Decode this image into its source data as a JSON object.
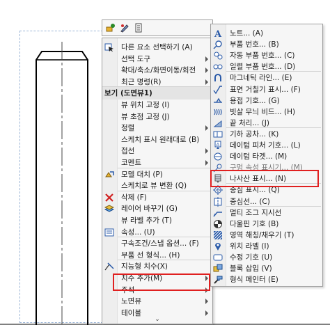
{
  "toolbar": {
    "icons": [
      "smart-dimension-icon",
      "annotation-pen-icon",
      "document-properties-icon"
    ]
  },
  "context_menu": {
    "items": [
      {
        "label": "다른 요소 선택하기 (A)",
        "icon": "select-other-icon"
      },
      {
        "label": "선택 도구",
        "submenu": true
      },
      {
        "label": "확대/축소/화면이동/회전",
        "submenu": true
      },
      {
        "label": "최근 명령(R)",
        "submenu": true
      },
      {
        "label": "보기 (도면뷰1)",
        "section": true
      },
      {
        "label": "뷰 위치 고정 (I)"
      },
      {
        "label": "뷰 초점 고정 (J)"
      },
      {
        "label": "정렬",
        "submenu": true
      },
      {
        "label": "스케치 표시 원래대로 (B)"
      },
      {
        "label": "접선",
        "submenu": true
      },
      {
        "label": "코멘트",
        "submenu": true
      },
      {
        "label": "모델 대치 (P)",
        "icon": "replace-model-icon"
      },
      {
        "label": "스케치로 뷰 변환 (Q)"
      },
      {
        "label": "삭제 (F)",
        "icon": "delete-icon"
      },
      {
        "label": "레이어 바꾸기 (G)",
        "icon": "change-layer-icon"
      },
      {
        "label": "뷰 라벨 추가 (T)"
      },
      {
        "label": "속성... (U)",
        "icon": "properties-icon"
      },
      {
        "label": "구속조건/스냅 옵션... (F)"
      },
      {
        "label": "부품 선 형식... (H)"
      },
      {
        "label": "지능형 치수(X)",
        "icon": "smart-dimension-menu-icon"
      },
      {
        "label": "치수 추가(M)",
        "submenu": true
      },
      {
        "label": "주석",
        "submenu": true,
        "highlighted": true
      },
      {
        "label": "노면뷰",
        "submenu": true
      },
      {
        "label": "테이블",
        "submenu": true
      }
    ]
  },
  "annotation_submenu": {
    "items": [
      {
        "label": "노트... (A)",
        "icon": "note-icon"
      },
      {
        "label": "부품 번호... (B)",
        "icon": "balloon-icon"
      },
      {
        "label": "자동 부품 번호... (C)",
        "icon": "auto-balloon-icon"
      },
      {
        "label": "일렬 부품 번호... (D)",
        "icon": "stacked-balloon-icon"
      },
      {
        "label": "마그네틱 라인... (E)",
        "icon": "magnetic-line-icon"
      },
      {
        "label": "표면 거칠기 표시... (F)",
        "icon": "surface-finish-icon"
      },
      {
        "label": "용접 기호... (G)",
        "icon": "weld-symbol-icon"
      },
      {
        "label": "빗살 무늬 비드... (H)",
        "icon": "weld-bead-icon"
      },
      {
        "label": "끝 처리... (J)",
        "icon": "end-treatment-icon"
      },
      {
        "label": "기하 공차... (K)",
        "icon": "geometric-tolerance-icon"
      },
      {
        "label": "데이텀 피처 기호... (L)",
        "icon": "datum-feature-icon"
      },
      {
        "label": "데이텀 타겟... (M)",
        "icon": "datum-target-icon"
      },
      {
        "label": "구멍 속성 표시기... (M)",
        "icon": "hole-callout-icon",
        "partial": true
      },
      {
        "label": "나사산 표시... (N)",
        "icon": "cosmetic-thread-icon",
        "highlighted": true
      },
      {
        "label": "중심 표시... (Q)",
        "icon": "center-mark-icon"
      },
      {
        "label": "중심선... (C)",
        "icon": "centerline-icon"
      },
      {
        "label": "멀티 조그 지시선",
        "icon": "multi-jog-leader-icon"
      },
      {
        "label": "다울핀 기호 (B)",
        "icon": "dowel-pin-icon"
      },
      {
        "label": "영역 해칭/채우기 (T)",
        "icon": "area-hatch-icon"
      },
      {
        "label": "위치 라벨 (I)",
        "icon": "location-label-icon"
      },
      {
        "label": "수정 기호 (U)",
        "icon": "revision-symbol-icon"
      },
      {
        "label": "블록 삽입 (V)",
        "icon": "insert-block-icon"
      },
      {
        "label": "형식 페인터 (E)",
        "icon": "format-painter-icon"
      }
    ]
  },
  "colors": {
    "highlight_border": "#e02020",
    "menu_bg": "#f6f6f6",
    "section_bg": "#e4e4e4",
    "accent_blue": "#2a5aa8"
  }
}
